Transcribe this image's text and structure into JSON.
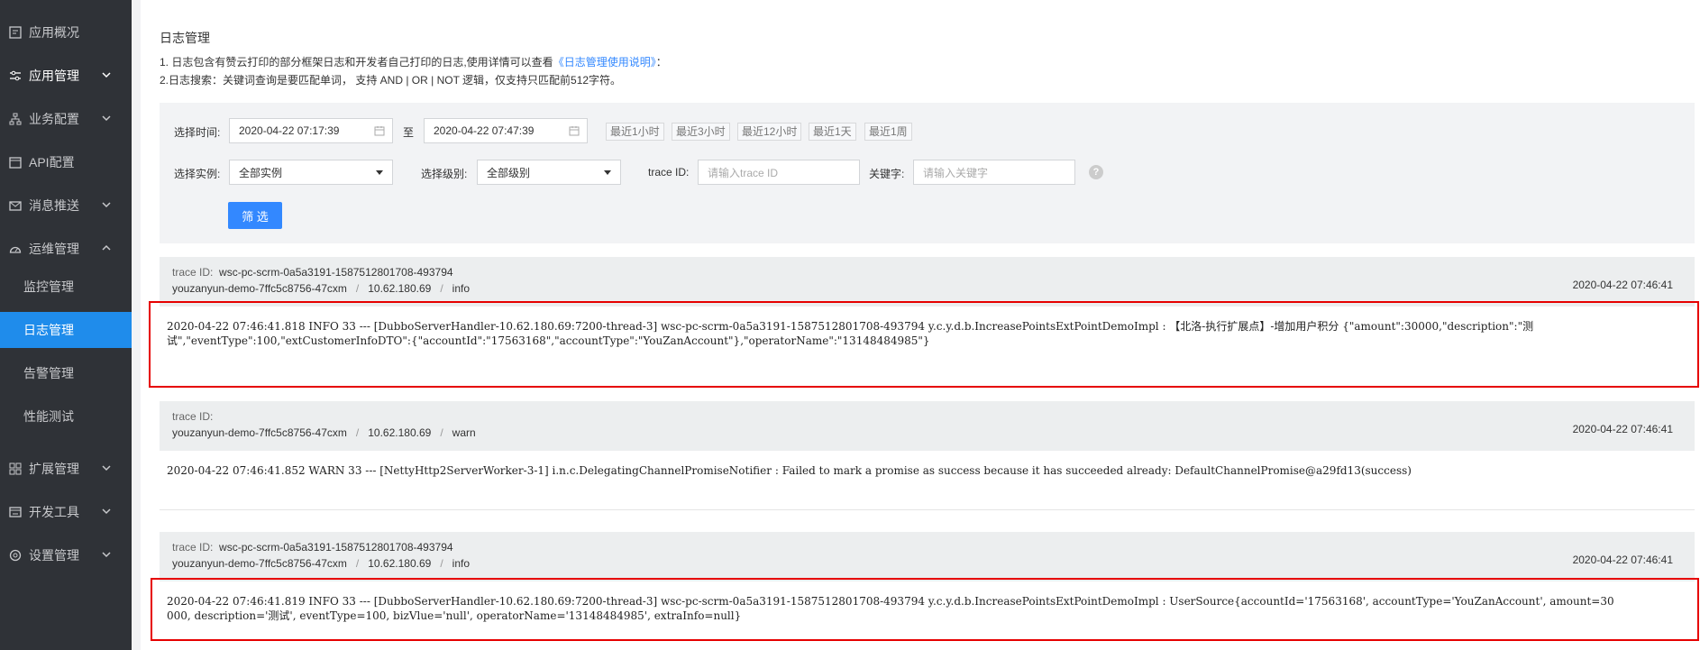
{
  "sidebar": {
    "items": [
      {
        "label": "应用概况",
        "icon": "overview-icon"
      },
      {
        "label": "应用管理",
        "icon": "sliders-icon"
      },
      {
        "label": "业务配置",
        "icon": "hierarchy-icon"
      },
      {
        "label": "API配置",
        "icon": "document-icon"
      },
      {
        "label": "消息推送",
        "icon": "mail-icon"
      },
      {
        "label": "运维管理",
        "icon": "dashboard-icon"
      },
      {
        "label": "扩展管理",
        "icon": "grid-icon"
      },
      {
        "label": "开发工具",
        "icon": "devtools-icon"
      },
      {
        "label": "设置管理",
        "icon": "gear-icon"
      }
    ],
    "ops_sub": [
      {
        "label": "监控管理"
      },
      {
        "label": "日志管理",
        "active": true
      },
      {
        "label": "告警管理"
      },
      {
        "label": "性能测试"
      }
    ]
  },
  "page": {
    "title": "日志管理",
    "intro1_pre": "1. 日志包含有赞云打印的部分框架日志和开发者自己打印的日志,使用详情可以查看",
    "intro1_link": "《日志管理使用说明》",
    "intro1_post": "：",
    "intro2": "2.日志搜索：关键词查询是要匹配单词，  支持 AND | OR | NOT 逻辑，仅支持只匹配前512字符。"
  },
  "filter": {
    "time_label": "选择时间:",
    "start_time": "2020-04-22 07:17:39",
    "to_label": "至",
    "end_time": "2020-04-22 07:47:39",
    "quick_ranges": [
      "最近1小时",
      "最近3小时",
      "最近12小时",
      "最近1天",
      "最近1周"
    ],
    "instance_label": "选择实例:",
    "instance_value": "全部实例",
    "level_label": "选择级别:",
    "level_value": "全部级别",
    "trace_label": "trace ID:",
    "trace_placeholder": "请输入trace ID",
    "keyword_label": "关键字:",
    "keyword_placeholder": "请输入关键字",
    "help": "?",
    "submit": "筛 选"
  },
  "logs": [
    {
      "trace_label": "trace ID:",
      "trace_id": "wsc-pc-scrm-0a5a3191-1587512801708-493794",
      "instance": "youzanyun-demo-7ffc5c8756-47cxm",
      "sep": "/",
      "ip": "10.62.180.69",
      "level": "info",
      "time": "2020-04-22 07:46:41",
      "line1": "2020-04-22 07:46:41.818  INFO 33 --- [DubboServerHandler-10.62.180.69:7200-thread-3] wsc-pc-scrm-0a5a3191-1587512801708-493794 y.c.y.d.b.IncreasePointsExtPointDemoImpl : 【北洛-执行扩展点】-增加用户积分 {\"amount\":30000,\"description\":\"测",
      "line2": "试\",\"eventType\":100,\"extCustomerInfoDTO\":{\"accountId\":\"17563168\",\"accountType\":\"YouZanAccount\"},\"operatorName\":\"13148484985\"}"
    },
    {
      "trace_label": "trace ID:",
      "trace_id": "",
      "instance": "youzanyun-demo-7ffc5c8756-47cxm",
      "sep": "/",
      "ip": "10.62.180.69",
      "level": "warn",
      "time": "2020-04-22 07:46:41",
      "line1": "2020-04-22 07:46:41.852  WARN 33 --- [NettyHttp2ServerWorker-3-1]  i.n.c.DelegatingChannelPromiseNotifier   : Failed to mark a promise as success because it has succeeded already: DefaultChannelPromise@a29fd13(success)",
      "line2": ""
    },
    {
      "trace_label": "trace ID:",
      "trace_id": "wsc-pc-scrm-0a5a3191-1587512801708-493794",
      "instance": "youzanyun-demo-7ffc5c8756-47cxm",
      "sep": "/",
      "ip": "10.62.180.69",
      "level": "info",
      "time": "2020-04-22 07:46:41",
      "line1": "2020-04-22 07:46:41.819  INFO 33 --- [DubboServerHandler-10.62.180.69:7200-thread-3] wsc-pc-scrm-0a5a3191-1587512801708-493794 y.c.y.d.b.IncreasePointsExtPointDemoImpl : UserSource{accountId='17563168', accountType='YouZanAccount', amount=30",
      "line2": "000, description='测试', eventType=100, bizVlue='null', operatorName='13148484985', extraInfo=null}"
    }
  ],
  "colors": {
    "sidebar_bg": "#2f3237",
    "active": "#1f8ceb",
    "link": "#3388ff",
    "highlight": "#e60000"
  }
}
